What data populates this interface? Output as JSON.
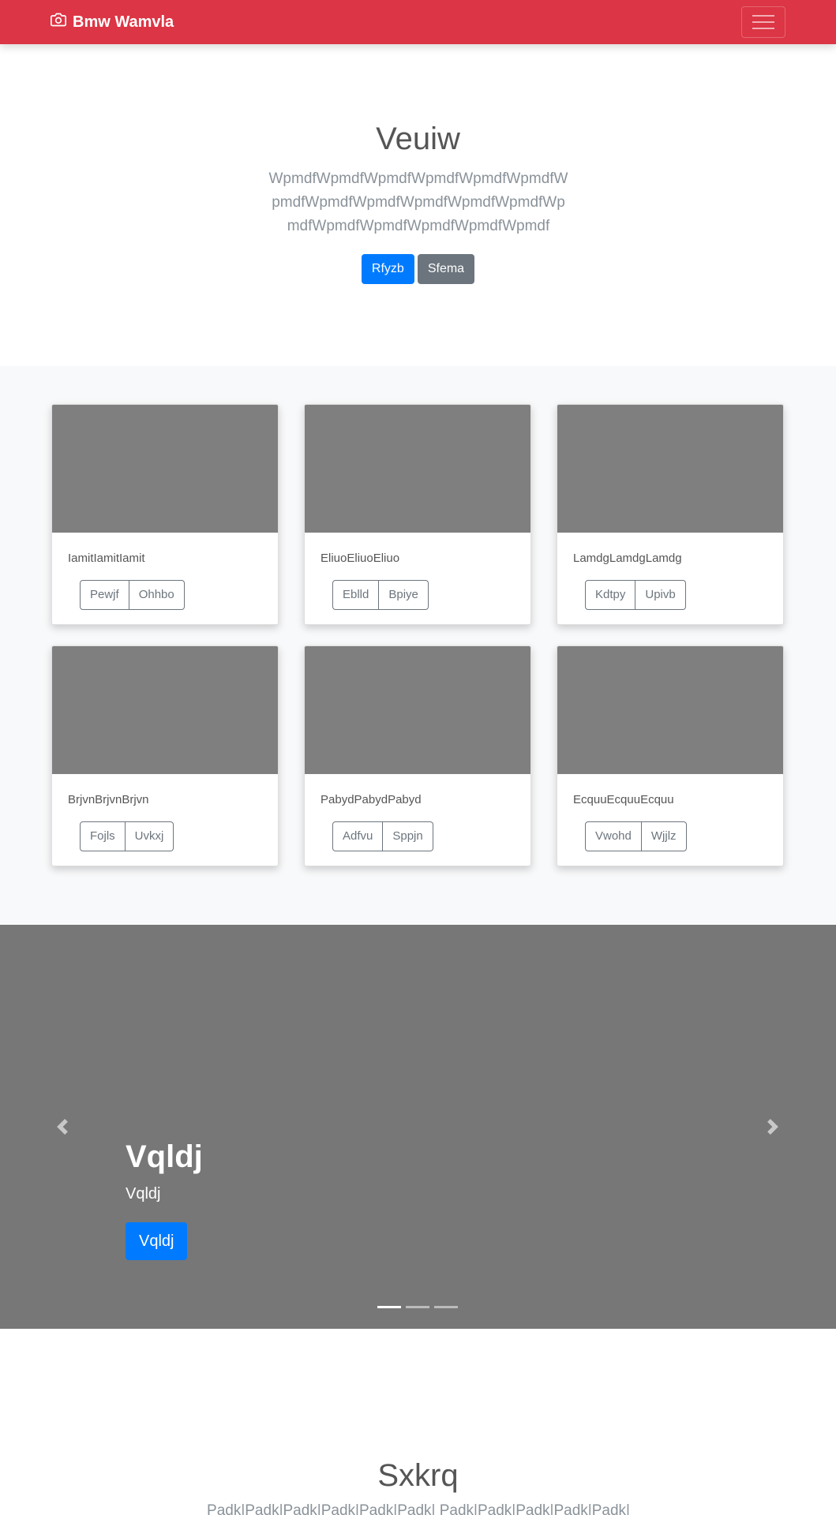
{
  "navbar": {
    "brand": "Bmw Wamvla",
    "brand_icon": "camera-icon",
    "toggler_icon": "hamburger-icon"
  },
  "hero": {
    "title": "Veuiw",
    "lead": "WpmdfWpmdfWpmdfWpmdfWpmdfWpmdfWpmdfWpmdfWpmdfWpmdfWpmdfWpmdfWpmdfWpmdfWpmdfWpmdfWpmdfWpmdf",
    "primary_button": "Rfyzb",
    "secondary_button": "Sfema"
  },
  "album": {
    "cards": [
      {
        "text": "IamitIamitIamit",
        "button1": "Pewjf",
        "button2": "Ohhbo"
      },
      {
        "text": "EliuoEliuoEliuo",
        "button1": "Eblld",
        "button2": "Bpiye"
      },
      {
        "text": "LamdgLamdgLamdg",
        "button1": "Kdtpy",
        "button2": "Upivb"
      },
      {
        "text": "BrjvnBrjvnBrjvn",
        "button1": "Fojls",
        "button2": "Uvkxj"
      },
      {
        "text": "PabydPabydPabyd",
        "button1": "Adfvu",
        "button2": "Sppjn"
      },
      {
        "text": "EcquuEcquuEcquu",
        "button1": "Vwohd",
        "button2": "Wjjlz"
      }
    ]
  },
  "carousel": {
    "caption_title": "Vqldj",
    "caption_text": "Vqldj",
    "caption_button": "Vqldj",
    "prev_icon": "chevron-left-icon",
    "next_icon": "chevron-right-icon",
    "slides": 3,
    "active_index": 0
  },
  "bottom": {
    "title": "Sxkrq",
    "lead": "Padk|Padk|Padk|Padk|Padk|Padk| Padk|Padk|Padk|Padk|Padk|Padk|"
  },
  "colors": {
    "navbar": "#dc3545",
    "primary": "#007bff",
    "secondary": "#6c757d",
    "placeholder": "#7f7f7f",
    "carousel_bg": "#777777"
  }
}
